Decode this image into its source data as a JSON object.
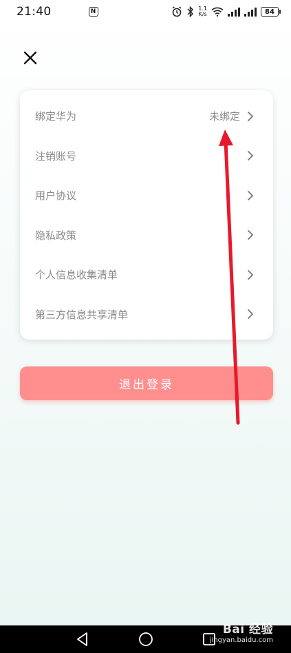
{
  "status_bar": {
    "time": "21:40",
    "nfc_glyph": "N",
    "speed_value": "1.1",
    "speed_unit": "K/s",
    "battery": "84",
    "icons": [
      "nfc-icon",
      "alarm-icon",
      "bluetooth-icon",
      "wifi-icon",
      "signal-icon",
      "signal-icon",
      "battery-icon"
    ]
  },
  "header": {
    "close_icon": "close-icon"
  },
  "settings": {
    "items": [
      {
        "label": "绑定华为",
        "value": "未绑定"
      },
      {
        "label": "注销账号",
        "value": ""
      },
      {
        "label": "用户协议",
        "value": ""
      },
      {
        "label": "隐私政策",
        "value": ""
      },
      {
        "label": "个人信息收集清单",
        "value": ""
      },
      {
        "label": "第三方信息共享清单",
        "value": ""
      }
    ]
  },
  "logout": {
    "label": "退出登录"
  },
  "navigation": {
    "back": "back-icon",
    "home": "home-icon",
    "recents": "recents-icon"
  },
  "watermark": {
    "main": "Bai 经验",
    "sub": "jingyan.baidu.com"
  },
  "colors": {
    "logout_button": "#ff8f8f",
    "annotation_arrow": "#e8192c",
    "label_text": "#8a8a8a",
    "nav_bar": "#000000"
  }
}
